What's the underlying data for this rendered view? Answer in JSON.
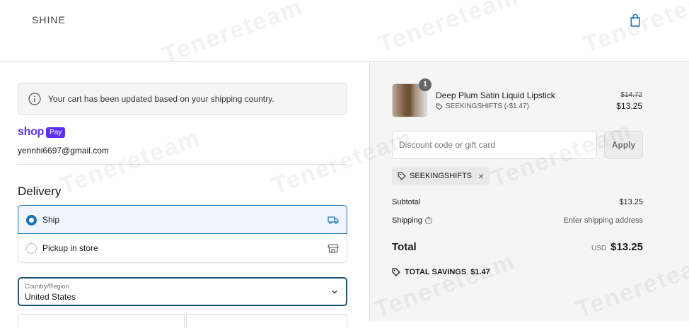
{
  "header": {
    "logo": "SHINE"
  },
  "notice": {
    "text": "Your cart has been updated based on your shipping country."
  },
  "shop_pay": {
    "word": "shop",
    "badge": "Pay",
    "brand_color": "#5a31f4"
  },
  "account": {
    "email": "yennhi6697@gmail.com"
  },
  "delivery": {
    "title": "Delivery",
    "options": [
      {
        "label": "Ship",
        "selected": true,
        "icon": "truck-icon"
      },
      {
        "label": "Pickup in store",
        "selected": false,
        "icon": "store-icon"
      }
    ],
    "country": {
      "caption": "Country/Region",
      "value": "United States"
    }
  },
  "order": {
    "item": {
      "name": "Deep Plum Satin Liquid Lipstick",
      "quantity": "1",
      "discount_tag": "SEEKINGSHIFTS (-$1.47)",
      "original_price": "$14.72",
      "price": "$13.25"
    },
    "discount": {
      "placeholder": "Discount code or gift card",
      "apply_label": "Apply"
    },
    "applied_code": "SEEKINGSHIFTS",
    "subtotal_label": "Subtotal",
    "subtotal_value": "$13.25",
    "shipping_label": "Shipping",
    "shipping_value": "Enter shipping address",
    "total_label": "Total",
    "total_currency": "USD",
    "total_value": "$13.25",
    "savings_label": "TOTAL SAVINGS",
    "savings_value": "$1.47"
  },
  "watermark": "Tenereteam",
  "colors": {
    "accent": "#1773b0",
    "shop_pay": "#5a31f4",
    "summary_bg": "#f5f5f5"
  }
}
